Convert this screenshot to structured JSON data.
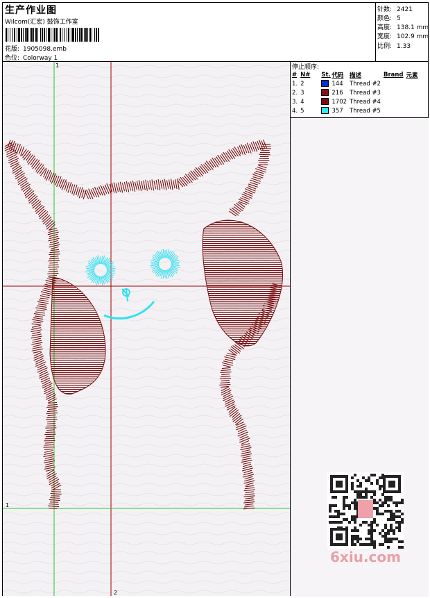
{
  "header": {
    "title": "生产作业图",
    "company": "Wilcom(汇宏) 鼓饰工作室",
    "design_label": "花版:",
    "design_file": "1905098.emb",
    "colorway_label": "色位:",
    "colorway": "Colorway 1"
  },
  "stats": [
    {
      "label": "针数:",
      "value": "2421"
    },
    {
      "label": "颜色:",
      "value": "5"
    },
    {
      "label": "高度:",
      "value": "138.1 mm"
    },
    {
      "label": "宽度:",
      "value": "102.9 mm"
    },
    {
      "label": "比例:",
      "value": "1.33"
    }
  ],
  "stop_sequence": {
    "title": "停止顺序:",
    "columns": [
      "#",
      "N#",
      "St.",
      "代码",
      "描述",
      "Brand",
      "元素"
    ],
    "rows": [
      {
        "idx": "1.",
        "n": "2",
        "stitches": "144",
        "desc": "Thread #2",
        "color": "#0033cc"
      },
      {
        "idx": "2.",
        "n": "3",
        "stitches": "216",
        "desc": "Thread #3",
        "color": "#8b1010"
      },
      {
        "idx": "3.",
        "n": "4",
        "stitches": "1702",
        "desc": "Thread #4",
        "color": "#7a0f0f"
      },
      {
        "idx": "4.",
        "n": "5",
        "stitches": "357",
        "desc": "Thread #5",
        "color": "#33e5f0"
      }
    ]
  },
  "guides": {
    "h_label": "1",
    "v_label_top": "1",
    "v_label_bottom": "2"
  },
  "watermark": "6xiu.com",
  "colors": {
    "thread_red": "#7a0f0f",
    "thread_cyan": "#33e0f0",
    "guide_green": "#22cc22",
    "guide_red": "#990000"
  }
}
